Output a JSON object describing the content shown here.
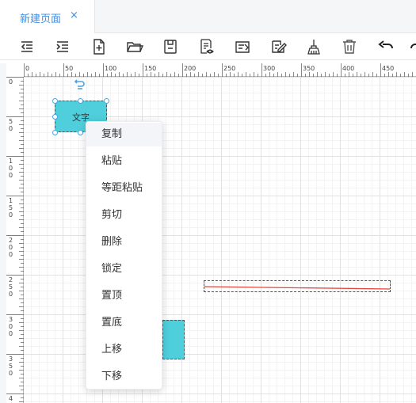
{
  "tab": {
    "label": "新建页面",
    "close": "×"
  },
  "toolbar": {
    "buttons": [
      {
        "name": "outdent-icon"
      },
      {
        "name": "indent-icon"
      },
      {
        "name": "new-file-icon"
      },
      {
        "name": "open-folder-icon"
      },
      {
        "name": "save-icon"
      },
      {
        "name": "preview-icon"
      },
      {
        "name": "import-icon"
      },
      {
        "name": "edit-icon"
      },
      {
        "name": "clear-brush-icon"
      },
      {
        "name": "delete-icon"
      },
      {
        "name": "undo-icon"
      },
      {
        "name": "redo-icon"
      }
    ]
  },
  "ruler": {
    "top_labels": [
      "0",
      "50",
      "100",
      "150",
      "200",
      "250",
      "300",
      "350",
      "400",
      "450"
    ],
    "left_labels": [
      [
        "0"
      ],
      [
        "5",
        "0"
      ],
      [
        "1",
        "0",
        "0"
      ],
      [
        "1",
        "5",
        "0"
      ],
      [
        "2",
        "0",
        "0"
      ],
      [
        "2",
        "5",
        "0"
      ],
      [
        "3",
        "0",
        "0"
      ],
      [
        "3",
        "5",
        "0"
      ],
      [
        "4"
      ]
    ]
  },
  "canvas": {
    "text_shape_label": "文字"
  },
  "context_menu": {
    "items": [
      "复制",
      "粘贴",
      "等距粘贴",
      "剪切",
      "删除",
      "锁定",
      "置顶",
      "置底",
      "上移",
      "下移"
    ]
  },
  "colors": {
    "accent": "#3a8ee6",
    "shape_fill": "#4fcfdc",
    "line": "#e0473f",
    "handle": "#4fa3e0"
  }
}
